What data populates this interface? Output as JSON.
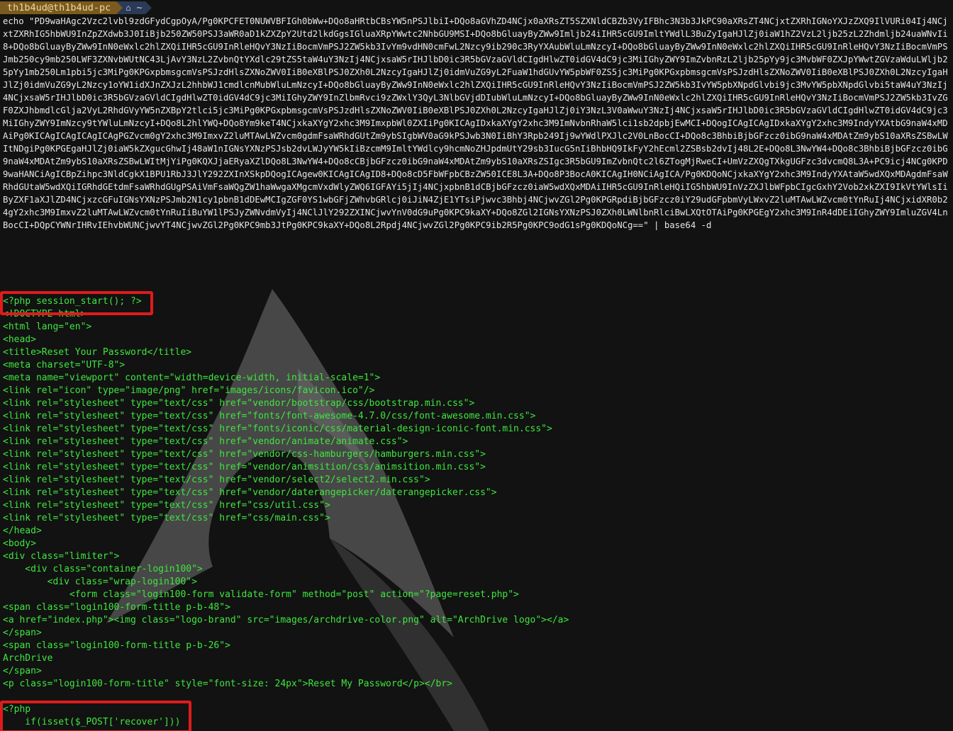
{
  "prompt": {
    "user_host": "th1b4ud@th1b4ud-pc",
    "path": "~",
    "command": "echo \"PD9waHAgc2Vzc2lvbl9zdGFydCgpOyA/Pg0KPCFET0NUWVBFIGh0bWw+DQo8aHRtbCBsYW5nPSJlbiI+DQo8aGVhZD4NCjx0aXRsZT5SZXNldCBZb3VyIFBhc3N3b3JkPC90aXRsZT4NCjxtZXRhIGNoYXJzZXQ9IlVURi04Ij4NCjxtZXRhIG5hbWU9InZpZXdwb3J0IiBjb250ZW50PSJ3aWR0aD1kZXZpY2Utd2lkdGgsIGluaXRpYWwtc2NhbGU9MSI+DQo8bGluayByZWw9Imljb24iIHR5cGU9ImltYWdlL3BuZyIgaHJlZj0iaW1hZ2VzL2ljb25zL2Zhdmljb24uaWNvIi8+DQo8bGluayByZWw9InN0eWxlc2hlZXQiIHR5cGU9InRleHQvY3NzIiBocmVmPSJ2ZW5kb3IvYm9vdHN0cmFwL2Nzcy9ib290c3RyYXAubWluLmNzcyI+DQo8bGluayByZWw9InN0eWxlc2hlZXQiIHR5cGU9InRleHQvY3NzIiBocmVmPSJmb250cy9mb250LWF3ZXNvbWUtNC43LjAvY3NzL2ZvbnQtYXdlc29tZS5taW4uY3NzIj4NCjxsaW5rIHJlbD0ic3R5bGVzaGVldCIgdHlwZT0idGV4dC9jc3MiIGhyZWY9ImZvbnRzL2ljb25pYy9jc3MvbWF0ZXJpYWwtZGVzaWduLWljb25pYy1mb250Lm1pbi5jc3MiPg0KPGxpbmsgcmVsPSJzdHlsZXNoZWV0IiB0eXBlPSJ0ZXh0L2NzcyIgaHJlZj0idmVuZG9yL2FuaW1hdGUvYW5pbWF0ZS5jc3MiPg0KPGxpbmsgcmVsPSJzdHlsZXNoZWV0IiB0eXBlPSJ0ZXh0L2NzcyIgaHJlZj0idmVuZG9yL2Nzcy1oYW1idXJnZXJzL2hhbWJ1cmdlcnMubWluLmNzcyI+DQo8bGluayByZWw9InN0eWxlc2hlZXQiIHR5cGU9InRleHQvY3NzIiBocmVmPSJ2ZW5kb3IvYW5pbXNpdGlvbi9jc3MvYW5pbXNpdGlvbi5taW4uY3NzIj4NCjxsaW5rIHJlbD0ic3R5bGVzaGVldCIgdHlwZT0idGV4dC9jc3MiIGhyZWY9InZlbmRvci9zZWxlY3QyL3NlbGVjdDIubWluLmNzcyI+DQo8bGluayByZWw9InN0eWxlc2hlZXQiIHR5cGU9InRleHQvY3NzIiBocmVmPSJ2ZW5kb3IvZGF0ZXJhbmdlcGlja2VyL2RhdGVyYW5nZXBpY2tlci5jc3MiPg0KPGxpbmsgcmVsPSJzdHlsZXNoZWV0IiB0eXBlPSJ0ZXh0L2NzcyIgaHJlZj0iY3NzL3V0aWwuY3NzIj4NCjxsaW5rIHJlbD0ic3R5bGVzaGVldCIgdHlwZT0idGV4dC9jc3MiIGhyZWY9ImNzcy9tYWluLmNzcyI+DQo8L2hlYWQ+DQo8Ym9keT4NCjxkaXYgY2xhc3M9ImxpbWl0ZXIiPg0KICAgIDxkaXYgY2xhc3M9ImNvbnRhaW5lci1sb2dpbjEwMCI+DQogICAgICAgIDxkaXYgY2xhc3M9IndyYXAtbG9naW4xMDAiPg0KICAgICAgICAgICAgPGZvcm0gY2xhc3M9ImxvZ2luMTAwLWZvcm0gdmFsaWRhdGUtZm9ybSIgbWV0aG9kPSJwb3N0IiBhY3Rpb249Ij9wYWdlPXJlc2V0LnBocCI+DQo8c3BhbiBjbGFzcz0ibG9naW4xMDAtZm9ybS10aXRsZSBwLWItNDgiPg0KPGEgaHJlZj0iaW5kZXgucGhwIj48aW1nIGNsYXNzPSJsb2dvLWJyYW5kIiBzcmM9ImltYWdlcy9hcmNoZHJpdmUtY29sb3IucG5nIiBhbHQ9IkFyY2hEcml2ZSBsb2dvIj48L2E+DQo8L3NwYW4+DQo8c3BhbiBjbGFzcz0ibG9naW4xMDAtZm9ybS10aXRsZSBwLWItMjYiPg0KQXJjaERyaXZlDQo8L3NwYW4+DQo8cCBjbGFzcz0ibG9naW4xMDAtZm9ybS10aXRsZSIgc3R5bGU9ImZvbnQtc2l6ZTogMjRweCI+UmVzZXQgTXkgUGFzc3dvcmQ8L3A+PC9icj4NCg0KPD9waHANCiAgICBpZihpc3NldCgkX1BPU1RbJ3JlY292ZXInXSkpDQogICAgew0KICAgICAgID8+DQo8cD5FbWFpbCBzZW50ICE8L3A+DQo8P3BocA0KICAgIH0NCiAgICA/Pg0KDQoNCjxkaXYgY2xhc3M9IndyYXAtaW5wdXQxMDAgdmFsaWRhdGUtaW5wdXQiIGRhdGEtdmFsaWRhdGUgPSAiVmFsaWQgZW1haWwgaXMgcmVxdWlyZWQ6IGFAYi5jIj4NCjxpbnB1dCBjbGFzcz0iaW5wdXQxMDAiIHR5cGU9InRleHQiIG5hbWU9InVzZXJlbWFpbCIgcGxhY2Vob2xkZXI9IkVtYWlsIiByZXF1aXJlZD4NCjxzcGFuIGNsYXNzPSJmb2N1cy1pbnB1dDEwMCIgZGF0YS1wbGFjZWhvbGRlcj0iJiN4ZjE1YTsiPjwvc3Bhbj4NCjwvZGl2Pg0KPGRpdiBjbGFzcz0iY29udGFpbmVyLWxvZ2luMTAwLWZvcm0tYnRuIj4NCjxidXR0b24gY2xhc3M9ImxvZ2luMTAwLWZvcm0tYnRuIiBuYW1lPSJyZWNvdmVyIj4NClJlY292ZXINCjwvYnV0dG9uPg0KPC9kaXY+DQo8ZGl2IGNsYXNzPSJ0ZXh0LWNlbnRlciBwLXQtOTAiPg0KPGEgY2xhc3M9InR4dDEiIGhyZWY9ImluZGV4LnBocCI+DQpCYWNrIHRvIEhvbWUNCjwvYT4NCjwvZGl2Pg0KPC9mb3JtPg0KPC9kaXY+DQo8L2Rpdj4NCjwvZGl2Pg0KPC9ib2R5Pg0KPC9odG1sPg0KDQoNCg==\" | base64 -d"
  },
  "decoded_lines": [
    "<?php session_start(); ?>",
    "<!DOCTYPE html>",
    "<html lang=\"en\">",
    "<head>",
    "<title>Reset Your Password</title>",
    "<meta charset=\"UTF-8\">",
    "<meta name=\"viewport\" content=\"width=device-width, initial-scale=1\">",
    "<link rel=\"icon\" type=\"image/png\" href=\"images/icons/favicon.ico\"/>",
    "<link rel=\"stylesheet\" type=\"text/css\" href=\"vendor/bootstrap/css/bootstrap.min.css\">",
    "<link rel=\"stylesheet\" type=\"text/css\" href=\"fonts/font-awesome-4.7.0/css/font-awesome.min.css\">",
    "<link rel=\"stylesheet\" type=\"text/css\" href=\"fonts/iconic/css/material-design-iconic-font.min.css\">",
    "<link rel=\"stylesheet\" type=\"text/css\" href=\"vendor/animate/animate.css\">",
    "<link rel=\"stylesheet\" type=\"text/css\" href=\"vendor/css-hamburgers/hamburgers.min.css\">",
    "<link rel=\"stylesheet\" type=\"text/css\" href=\"vendor/animsition/css/animsition.min.css\">",
    "<link rel=\"stylesheet\" type=\"text/css\" href=\"vendor/select2/select2.min.css\">",
    "<link rel=\"stylesheet\" type=\"text/css\" href=\"vendor/daterangepicker/daterangepicker.css\">",
    "<link rel=\"stylesheet\" type=\"text/css\" href=\"css/util.css\">",
    "<link rel=\"stylesheet\" type=\"text/css\" href=\"css/main.css\">",
    "</head>",
    "<body>",
    "<div class=\"limiter\">",
    "    <div class=\"container-login100\">",
    "        <div class=\"wrap-login100\">",
    "            <form class=\"login100-form validate-form\" method=\"post\" action=\"?page=reset.php\">",
    "<span class=\"login100-form-title p-b-48\">",
    "<a href=\"index.php\"><img class=\"logo-brand\" src=\"images/archdrive-color.png\" alt=\"ArchDrive logo\"></a>",
    "</span>",
    "<span class=\"login100-form-title p-b-26\">",
    "ArchDrive",
    "</span>",
    "<p class=\"login100-form-title\" style=\"font-size: 24px\">Reset My Password</p></br>",
    "",
    "<?php",
    "    if(isset($_POST['recover']))"
  ],
  "colors": {
    "terminal_bg": "#121212",
    "output_green": "#3ee63e",
    "highlight_red": "#e01b1b"
  },
  "icons": {
    "home": "home-icon",
    "watermark": "arch-linux-logo"
  }
}
